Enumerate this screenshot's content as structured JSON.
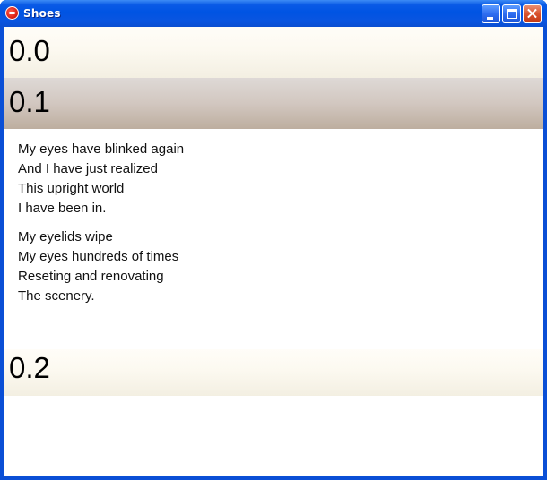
{
  "window": {
    "title": "Shoes",
    "icon": "shoes-app-icon",
    "controls": [
      "minimize",
      "maximize",
      "close"
    ]
  },
  "bands": [
    {
      "label": "0.0"
    },
    {
      "label": "0.1"
    },
    {
      "label": "0.2"
    }
  ],
  "poem": {
    "stanzas": [
      [
        "My eyes have blinked again",
        "And I have just realized",
        "This upright world",
        "I have been in."
      ],
      [
        "My eyelids wipe",
        "My eyes hundreds of times",
        "Reseting and renovating",
        "The scenery."
      ]
    ]
  },
  "colors": {
    "titlebar": "#0054e3",
    "frame": "#0a4fd6",
    "band_light": "#fcf9f0",
    "band_dark": "#c9bcb1"
  }
}
